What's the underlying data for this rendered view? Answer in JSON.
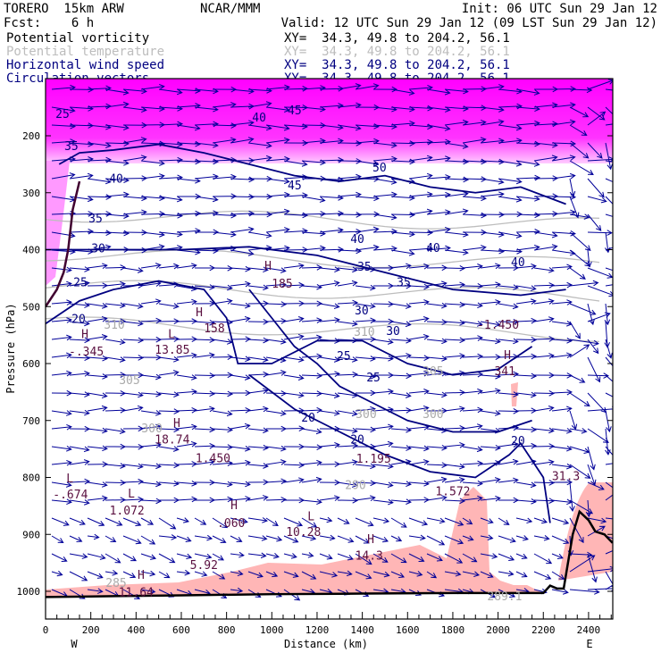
{
  "header": {
    "model": "TORERO  15km ARW",
    "org": "NCAR/MMM",
    "init": "Init: 06 UTC Sun 29 Jan 12",
    "fcst": "Fcst:    6 h",
    "valid": "Valid: 12 UTC Sun 29 Jan 12 (09 LST Sun 29 Jan 12)"
  },
  "legend": [
    {
      "name": "Potential vorticity",
      "xy": "XY=  34.3, 49.8 to 204.2, 56.1",
      "color": "#000000"
    },
    {
      "name": "Potential temperature",
      "xy": "XY=  34.3, 49.8 to 204.2, 56.1",
      "color": "#bdbdbd"
    },
    {
      "name": "Horizontal wind speed",
      "xy": "XY=  34.3, 49.8 to 204.2, 56.1",
      "color": "#000080"
    },
    {
      "name": "Circulation vectors",
      "xy": "XY=  34.3, 49.8 to 204.2, 56.1",
      "color": "#000080"
    }
  ],
  "chart_data": {
    "type": "cross-section",
    "xlabel": "Distance (km)",
    "ylabel": "Pressure (hPa)",
    "xlim": [
      0,
      2506
    ],
    "ylim": [
      1050,
      100
    ],
    "xticks": [
      "0",
      "200",
      "400",
      "600",
      "800",
      "1000",
      "1200",
      "1400",
      "1600",
      "1800",
      "2000",
      "2200",
      "2400"
    ],
    "yticks": [
      "200",
      "300",
      "400",
      "500",
      "600",
      "700",
      "800",
      "900",
      "1000"
    ],
    "west_label": "W",
    "east_label": "E",
    "wind_speed_labels": [
      {
        "t": "25",
        "km": 75,
        "p": 169
      },
      {
        "t": "35",
        "km": 114,
        "p": 225
      },
      {
        "t": "40",
        "km": 312,
        "p": 282
      },
      {
        "t": "35",
        "km": 221,
        "p": 352
      },
      {
        "t": "30",
        "km": 233,
        "p": 405
      },
      {
        "t": "25",
        "km": 154,
        "p": 464
      },
      {
        "t": "20",
        "km": 146,
        "p": 529
      },
      {
        "t": "40",
        "km": 944,
        "p": 175
      },
      {
        "t": "45",
        "km": 1101,
        "p": 162
      },
      {
        "t": "45",
        "km": 1101,
        "p": 294
      },
      {
        "t": "50",
        "km": 1476,
        "p": 263
      },
      {
        "t": "40",
        "km": 1378,
        "p": 388
      },
      {
        "t": "40",
        "km": 1713,
        "p": 404
      },
      {
        "t": "40",
        "km": 2088,
        "p": 429
      },
      {
        "t": "35",
        "km": 1409,
        "p": 437
      },
      {
        "t": "35",
        "km": 1583,
        "p": 464
      },
      {
        "t": "30",
        "km": 1397,
        "p": 514
      },
      {
        "t": "30",
        "km": 1536,
        "p": 550
      },
      {
        "t": "25",
        "km": 1318,
        "p": 594
      },
      {
        "t": "25",
        "km": 1449,
        "p": 631
      },
      {
        "t": "20",
        "km": 1161,
        "p": 702
      },
      {
        "t": "20",
        "km": 1378,
        "p": 740
      },
      {
        "t": "20",
        "km": 2088,
        "p": 743
      }
    ],
    "theta_labels": [
      {
        "t": "310",
        "km": 304,
        "p": 539
      },
      {
        "t": "310",
        "km": 1409,
        "p": 551
      },
      {
        "t": "305",
        "km": 371,
        "p": 636
      },
      {
        "t": "305",
        "km": 1713,
        "p": 620
      },
      {
        "t": "300",
        "km": 470,
        "p": 721
      },
      {
        "t": "300",
        "km": 1417,
        "p": 696
      },
      {
        "t": "300",
        "km": 1713,
        "p": 696
      },
      {
        "t": "290",
        "km": 1370,
        "p": 820
      },
      {
        "t": "289.1",
        "km": 2029,
        "p": 1016
      },
      {
        "t": "285",
        "km": 312,
        "p": 992
      }
    ],
    "pv_labels": [
      {
        "t": "H",
        "km": 983,
        "p": 435
      },
      {
        "t": "185",
        "km": 1046,
        "p": 467
      },
      {
        "t": "H",
        "km": 174,
        "p": 555
      },
      {
        "t": "-.345",
        "km": 180,
        "p": 586
      },
      {
        "t": "L",
        "km": 557,
        "p": 555
      },
      {
        "t": "13.85",
        "km": 560,
        "p": 583
      },
      {
        "t": "H",
        "km": 679,
        "p": 517
      },
      {
        "t": "158",
        "km": 746,
        "p": 545
      },
      {
        "t": "H",
        "km": 580,
        "p": 711
      },
      {
        "t": "18.74",
        "km": 560,
        "p": 740
      },
      {
        "t": "1.450",
        "km": 740,
        "p": 773
      },
      {
        "t": "1.195",
        "km": 1450,
        "p": 774
      },
      {
        "t": "L",
        "km": 107,
        "p": 809
      },
      {
        "t": "-.674",
        "km": 110,
        "p": 837
      },
      {
        "t": "L",
        "km": 379,
        "p": 835
      },
      {
        "t": "1.072",
        "km": 360,
        "p": 865
      },
      {
        "t": "H",
        "km": 833,
        "p": 856
      },
      {
        "t": ".060",
        "km": 820,
        "p": 887
      },
      {
        "t": "L",
        "km": 1173,
        "p": 875
      },
      {
        "t": "10.28",
        "km": 1140,
        "p": 903
      },
      {
        "t": "H",
        "km": 1437,
        "p": 915
      },
      {
        "t": "14.3",
        "km": 1430,
        "p": 944
      },
      {
        "t": "5.92",
        "km": 700,
        "p": 961
      },
      {
        "t": "H",
        "km": 422,
        "p": 978
      },
      {
        "t": "11.64",
        "km": 400,
        "p": 1009
      },
      {
        "t": "1.572",
        "km": 1800,
        "p": 831
      },
      {
        "t": "H",
        "km": 2041,
        "p": 592
      },
      {
        "t": "341",
        "km": 2030,
        "p": 620
      },
      {
        "t": "-1.450",
        "km": 2000,
        "p": 539
      },
      {
        "t": "31.3",
        "km": 2300,
        "p": 805
      }
    ],
    "terrain": [
      [
        0,
        1010
      ],
      [
        200,
        1009
      ],
      [
        600,
        1007
      ],
      [
        1000,
        1005
      ],
      [
        1400,
        1004
      ],
      [
        1800,
        1003
      ],
      [
        2200,
        1003
      ],
      [
        2230,
        990
      ],
      [
        2260,
        995
      ],
      [
        2290,
        995
      ],
      [
        2330,
        900
      ],
      [
        2360,
        860
      ],
      [
        2400,
        875
      ],
      [
        2430,
        895
      ],
      [
        2470,
        900
      ],
      [
        2506,
        915
      ]
    ],
    "wind_speed_contours": [
      [
        [
          0,
          530
        ],
        [
          150,
          490
        ],
        [
          300,
          470
        ],
        [
          500,
          455
        ],
        [
          700,
          470
        ],
        [
          800,
          520
        ],
        [
          850,
          600
        ],
        [
          1000,
          600
        ],
        [
          1200,
          560
        ],
        [
          1400,
          560
        ],
        [
          1600,
          600
        ],
        [
          1800,
          620
        ],
        [
          2000,
          610
        ],
        [
          2150,
          570
        ]
      ],
      [
        [
          60,
          250
        ],
        [
          150,
          230
        ],
        [
          300,
          225
        ],
        [
          500,
          215
        ],
        [
          700,
          230
        ],
        [
          900,
          250
        ],
        [
          1100,
          270
        ],
        [
          1300,
          280
        ],
        [
          1500,
          270
        ],
        [
          1700,
          290
        ],
        [
          1900,
          300
        ],
        [
          2100,
          290
        ],
        [
          2300,
          320
        ]
      ],
      [
        [
          0,
          400
        ],
        [
          300,
          400
        ],
        [
          600,
          400
        ],
        [
          900,
          395
        ],
        [
          1200,
          410
        ],
        [
          1500,
          440
        ],
        [
          1800,
          470
        ],
        [
          2100,
          480
        ],
        [
          2300,
          470
        ]
      ],
      [
        [
          900,
          470
        ],
        [
          1000,
          520
        ],
        [
          1100,
          570
        ],
        [
          1200,
          600
        ],
        [
          1300,
          640
        ],
        [
          1450,
          670
        ],
        [
          1600,
          700
        ],
        [
          1800,
          720
        ],
        [
          2000,
          720
        ],
        [
          2150,
          700
        ]
      ],
      [
        [
          900,
          620
        ],
        [
          1100,
          680
        ],
        [
          1300,
          720
        ],
        [
          1500,
          760
        ],
        [
          1700,
          790
        ],
        [
          1900,
          800
        ],
        [
          2050,
          760
        ],
        [
          2100,
          740
        ],
        [
          2200,
          800
        ],
        [
          2230,
          880
        ]
      ]
    ],
    "pv_contours": [
      [
        [
          0,
          500
        ],
        [
          50,
          470
        ],
        [
          80,
          440
        ],
        [
          100,
          400
        ],
        [
          120,
          330
        ],
        [
          150,
          280
        ]
      ]
    ]
  }
}
